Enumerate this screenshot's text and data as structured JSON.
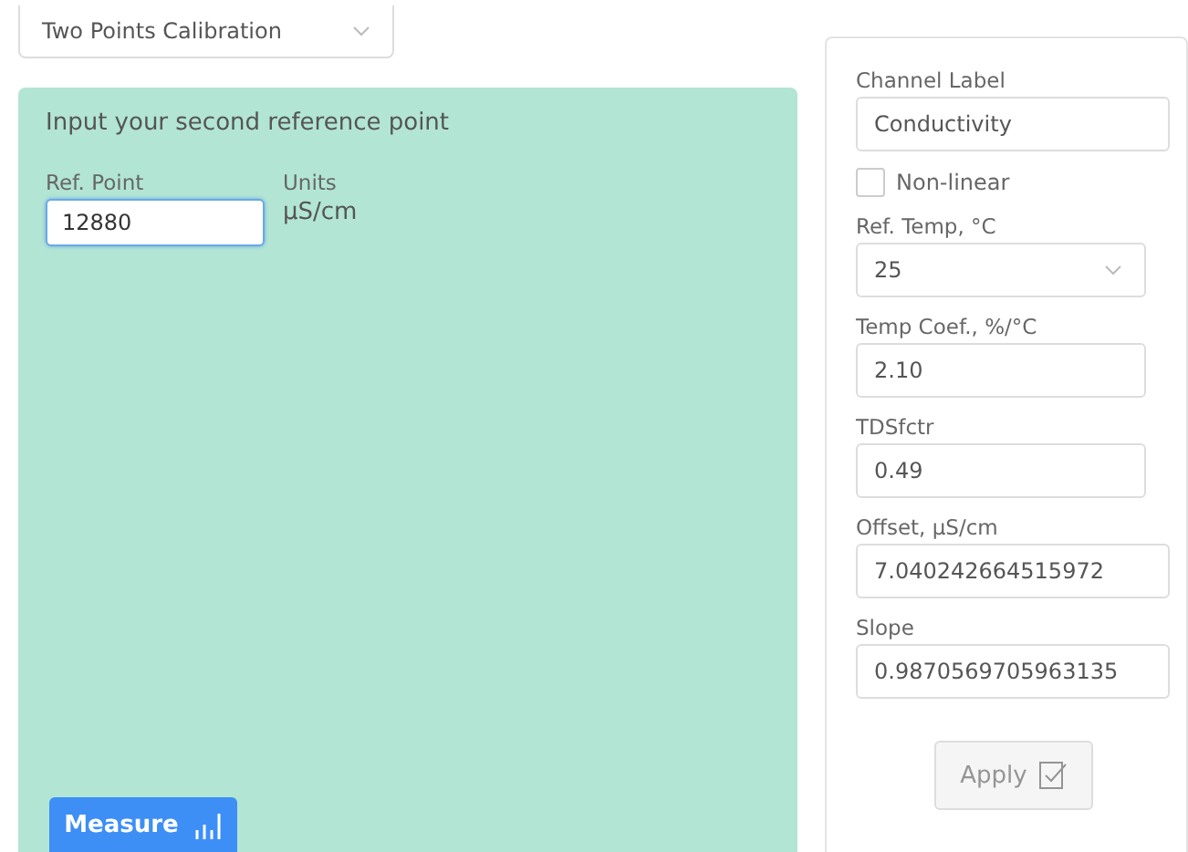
{
  "mode_select": {
    "value": "Two Points Calibration"
  },
  "calibration_panel": {
    "prompt": "Input your second reference point",
    "ref_point": {
      "label": "Ref. Point",
      "value": "12880"
    },
    "units": {
      "label": "Units",
      "value": "µS/cm"
    },
    "measure_button": {
      "label": "Measure"
    }
  },
  "settings": {
    "fields": [
      {
        "kind": "text",
        "label": "Channel Label",
        "value": "Conductivity"
      },
      {
        "kind": "checkbox",
        "label": "Non-linear",
        "checked": false
      },
      {
        "kind": "select",
        "label": "Ref. Temp, °C",
        "value": "25"
      },
      {
        "kind": "text",
        "label": "Temp Coef., %/°C",
        "value": "2.10"
      },
      {
        "kind": "text",
        "label": "TDSfctr",
        "value": "0.49"
      },
      {
        "kind": "text",
        "label": "Offset, µS/cm",
        "value": "7.040242664515972"
      },
      {
        "kind": "text",
        "label": "Slope",
        "value": "0.9870569705963135"
      }
    ],
    "apply_button": {
      "label": "Apply",
      "disabled": true
    }
  }
}
